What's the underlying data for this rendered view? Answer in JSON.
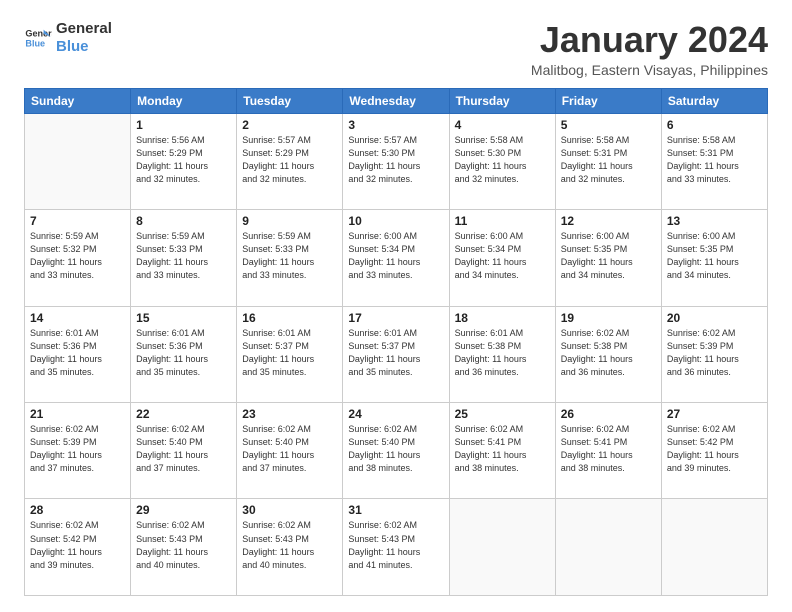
{
  "logo": {
    "line1": "General",
    "line2": "Blue"
  },
  "title": "January 2024",
  "location": "Malitbog, Eastern Visayas, Philippines",
  "days_of_week": [
    "Sunday",
    "Monday",
    "Tuesday",
    "Wednesday",
    "Thursday",
    "Friday",
    "Saturday"
  ],
  "weeks": [
    [
      {
        "day": "",
        "info": ""
      },
      {
        "day": "1",
        "info": "Sunrise: 5:56 AM\nSunset: 5:29 PM\nDaylight: 11 hours\nand 32 minutes."
      },
      {
        "day": "2",
        "info": "Sunrise: 5:57 AM\nSunset: 5:29 PM\nDaylight: 11 hours\nand 32 minutes."
      },
      {
        "day": "3",
        "info": "Sunrise: 5:57 AM\nSunset: 5:30 PM\nDaylight: 11 hours\nand 32 minutes."
      },
      {
        "day": "4",
        "info": "Sunrise: 5:58 AM\nSunset: 5:30 PM\nDaylight: 11 hours\nand 32 minutes."
      },
      {
        "day": "5",
        "info": "Sunrise: 5:58 AM\nSunset: 5:31 PM\nDaylight: 11 hours\nand 32 minutes."
      },
      {
        "day": "6",
        "info": "Sunrise: 5:58 AM\nSunset: 5:31 PM\nDaylight: 11 hours\nand 33 minutes."
      }
    ],
    [
      {
        "day": "7",
        "info": "Sunrise: 5:59 AM\nSunset: 5:32 PM\nDaylight: 11 hours\nand 33 minutes."
      },
      {
        "day": "8",
        "info": "Sunrise: 5:59 AM\nSunset: 5:33 PM\nDaylight: 11 hours\nand 33 minutes."
      },
      {
        "day": "9",
        "info": "Sunrise: 5:59 AM\nSunset: 5:33 PM\nDaylight: 11 hours\nand 33 minutes."
      },
      {
        "day": "10",
        "info": "Sunrise: 6:00 AM\nSunset: 5:34 PM\nDaylight: 11 hours\nand 33 minutes."
      },
      {
        "day": "11",
        "info": "Sunrise: 6:00 AM\nSunset: 5:34 PM\nDaylight: 11 hours\nand 34 minutes."
      },
      {
        "day": "12",
        "info": "Sunrise: 6:00 AM\nSunset: 5:35 PM\nDaylight: 11 hours\nand 34 minutes."
      },
      {
        "day": "13",
        "info": "Sunrise: 6:00 AM\nSunset: 5:35 PM\nDaylight: 11 hours\nand 34 minutes."
      }
    ],
    [
      {
        "day": "14",
        "info": "Sunrise: 6:01 AM\nSunset: 5:36 PM\nDaylight: 11 hours\nand 35 minutes."
      },
      {
        "day": "15",
        "info": "Sunrise: 6:01 AM\nSunset: 5:36 PM\nDaylight: 11 hours\nand 35 minutes."
      },
      {
        "day": "16",
        "info": "Sunrise: 6:01 AM\nSunset: 5:37 PM\nDaylight: 11 hours\nand 35 minutes."
      },
      {
        "day": "17",
        "info": "Sunrise: 6:01 AM\nSunset: 5:37 PM\nDaylight: 11 hours\nand 35 minutes."
      },
      {
        "day": "18",
        "info": "Sunrise: 6:01 AM\nSunset: 5:38 PM\nDaylight: 11 hours\nand 36 minutes."
      },
      {
        "day": "19",
        "info": "Sunrise: 6:02 AM\nSunset: 5:38 PM\nDaylight: 11 hours\nand 36 minutes."
      },
      {
        "day": "20",
        "info": "Sunrise: 6:02 AM\nSunset: 5:39 PM\nDaylight: 11 hours\nand 36 minutes."
      }
    ],
    [
      {
        "day": "21",
        "info": "Sunrise: 6:02 AM\nSunset: 5:39 PM\nDaylight: 11 hours\nand 37 minutes."
      },
      {
        "day": "22",
        "info": "Sunrise: 6:02 AM\nSunset: 5:40 PM\nDaylight: 11 hours\nand 37 minutes."
      },
      {
        "day": "23",
        "info": "Sunrise: 6:02 AM\nSunset: 5:40 PM\nDaylight: 11 hours\nand 37 minutes."
      },
      {
        "day": "24",
        "info": "Sunrise: 6:02 AM\nSunset: 5:40 PM\nDaylight: 11 hours\nand 38 minutes."
      },
      {
        "day": "25",
        "info": "Sunrise: 6:02 AM\nSunset: 5:41 PM\nDaylight: 11 hours\nand 38 minutes."
      },
      {
        "day": "26",
        "info": "Sunrise: 6:02 AM\nSunset: 5:41 PM\nDaylight: 11 hours\nand 38 minutes."
      },
      {
        "day": "27",
        "info": "Sunrise: 6:02 AM\nSunset: 5:42 PM\nDaylight: 11 hours\nand 39 minutes."
      }
    ],
    [
      {
        "day": "28",
        "info": "Sunrise: 6:02 AM\nSunset: 5:42 PM\nDaylight: 11 hours\nand 39 minutes."
      },
      {
        "day": "29",
        "info": "Sunrise: 6:02 AM\nSunset: 5:43 PM\nDaylight: 11 hours\nand 40 minutes."
      },
      {
        "day": "30",
        "info": "Sunrise: 6:02 AM\nSunset: 5:43 PM\nDaylight: 11 hours\nand 40 minutes."
      },
      {
        "day": "31",
        "info": "Sunrise: 6:02 AM\nSunset: 5:43 PM\nDaylight: 11 hours\nand 41 minutes."
      },
      {
        "day": "",
        "info": ""
      },
      {
        "day": "",
        "info": ""
      },
      {
        "day": "",
        "info": ""
      }
    ]
  ]
}
